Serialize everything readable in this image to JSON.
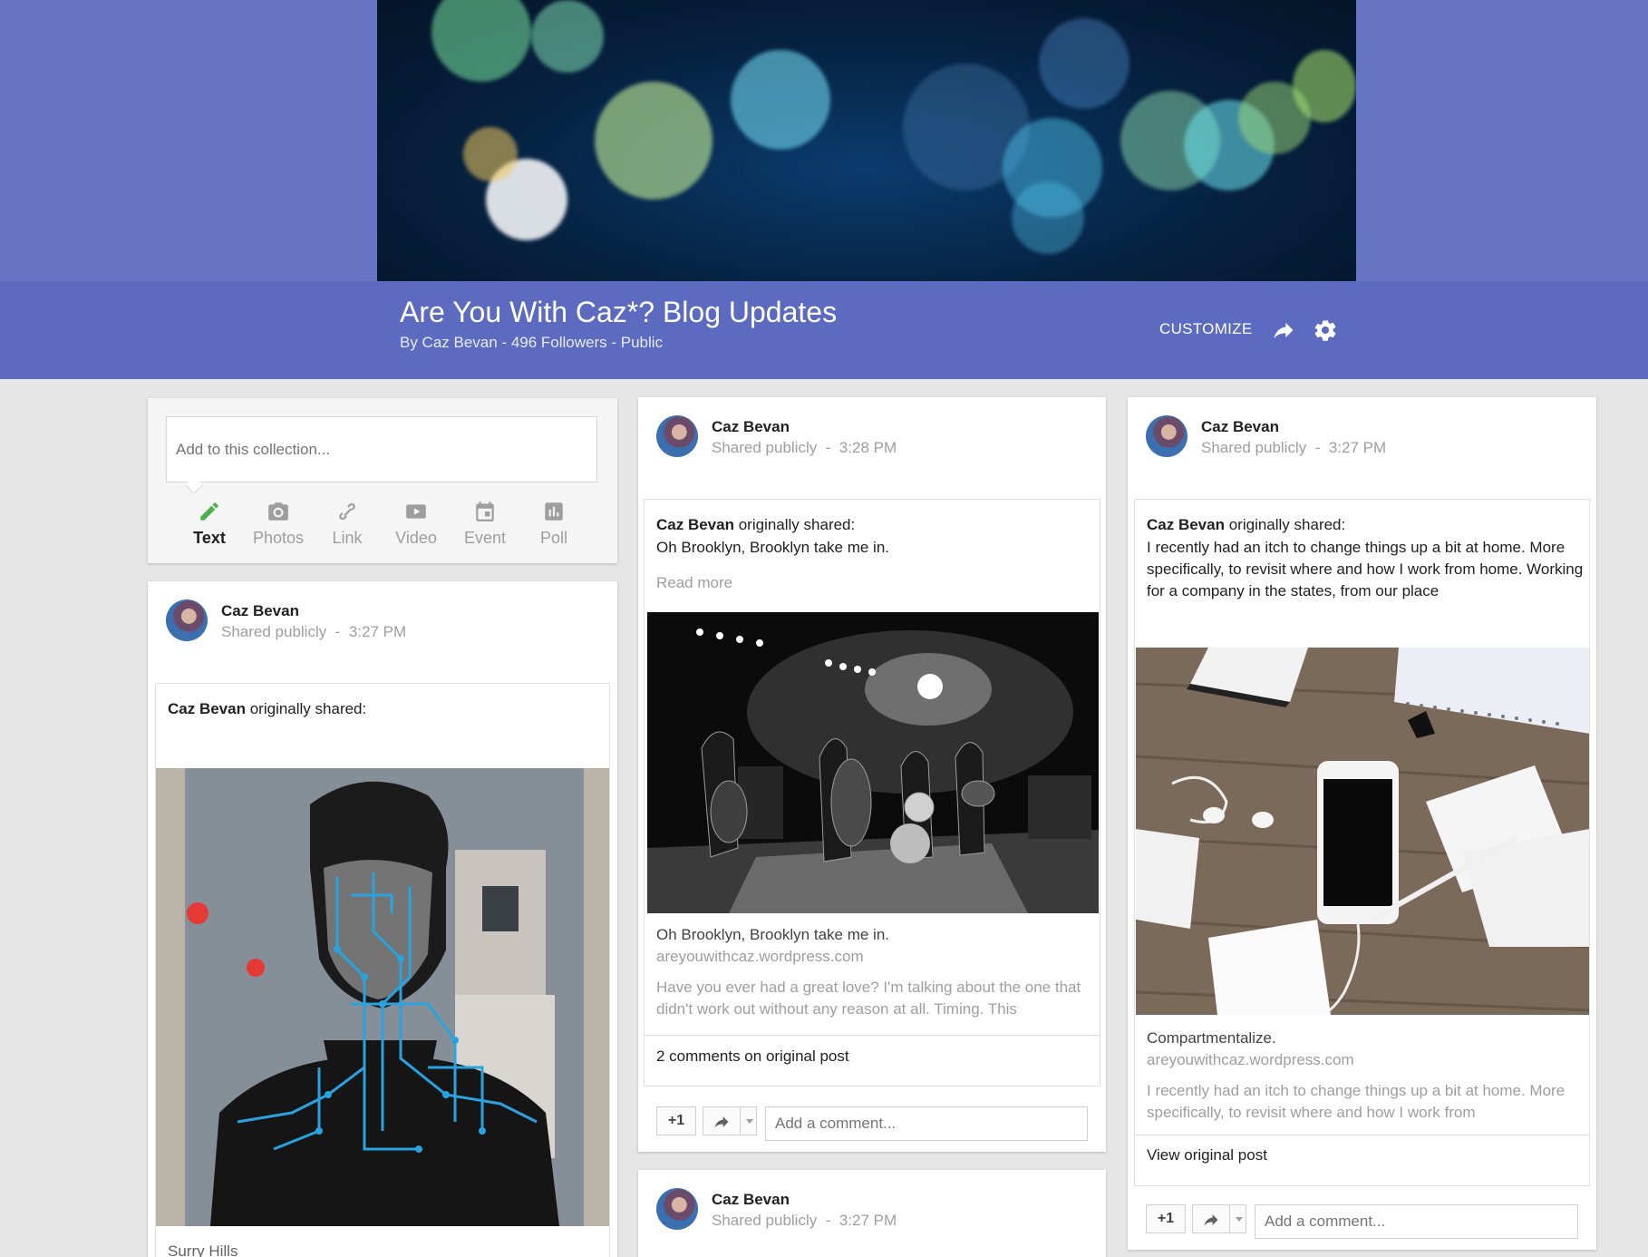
{
  "collection": {
    "title": "Are You With Caz*? Blog Updates",
    "byline": "By Caz Bevan - 496 Followers - Public",
    "customize_label": "CUSTOMIZE",
    "share_icon": "share-icon",
    "settings_icon": "gear-icon"
  },
  "composer": {
    "placeholder": "Add to this collection...",
    "tools": [
      {
        "label": "Text",
        "icon": "pencil-icon",
        "active": true
      },
      {
        "label": "Photos",
        "icon": "camera-icon"
      },
      {
        "label": "Link",
        "icon": "link-icon"
      },
      {
        "label": "Video",
        "icon": "video-icon"
      },
      {
        "label": "Event",
        "icon": "calendar-icon"
      },
      {
        "label": "Poll",
        "icon": "poll-icon"
      }
    ],
    "active_color": "#4caf50"
  },
  "posts": [
    {
      "author": "Caz Bevan",
      "visibility": "Shared publicly",
      "separator": "-",
      "time": "3:27 PM",
      "original_author": "Caz Bevan",
      "originally_shared": "originally shared:",
      "caption": "Surry Hills"
    },
    {
      "author": "Caz Bevan",
      "visibility": "Shared publicly",
      "separator": "-",
      "time": "3:28 PM",
      "original_author": "Caz Bevan",
      "originally_shared": "originally shared:",
      "text": "Oh Brooklyn, Brooklyn take me in.",
      "read_more": "Read more",
      "link_title": "Oh Brooklyn, Brooklyn take me in.",
      "link_domain": "areyouwithcaz.wordpress.com",
      "link_snippet": "Have you ever had a great love?  I'm talking about the one that didn't work out without any reason at all.  Timing.  This",
      "comments": "2 comments on original post",
      "plus_one": "+1",
      "comment_placeholder": "Add a comment..."
    },
    {
      "author": "Caz Bevan",
      "visibility": "Shared publicly",
      "separator": "-",
      "time": "3:27 PM",
      "original_author": "Caz Bevan",
      "originally_shared": "originally shared:",
      "text": "I recently had an itch to change things up a bit at home.  More specifically, to revisit where and how I work from home. Working for a company in the states, from our place",
      "link_title": "Compartmentalize.",
      "link_domain": "areyouwithcaz.wordpress.com",
      "link_snippet": "I recently had an itch to change things up a bit at home.  More specifically, to revisit where and how I work from",
      "view_original": "View original post",
      "plus_one": "+1",
      "comment_placeholder": "Add a comment..."
    },
    {
      "author": "Caz Bevan",
      "visibility": "Shared publicly",
      "separator": "-",
      "time": "3:27 PM"
    }
  ],
  "colors": {
    "header_bg": "#6674c4",
    "title_bar": "#5c6bc0",
    "page_bg": "#e6e6e6"
  }
}
